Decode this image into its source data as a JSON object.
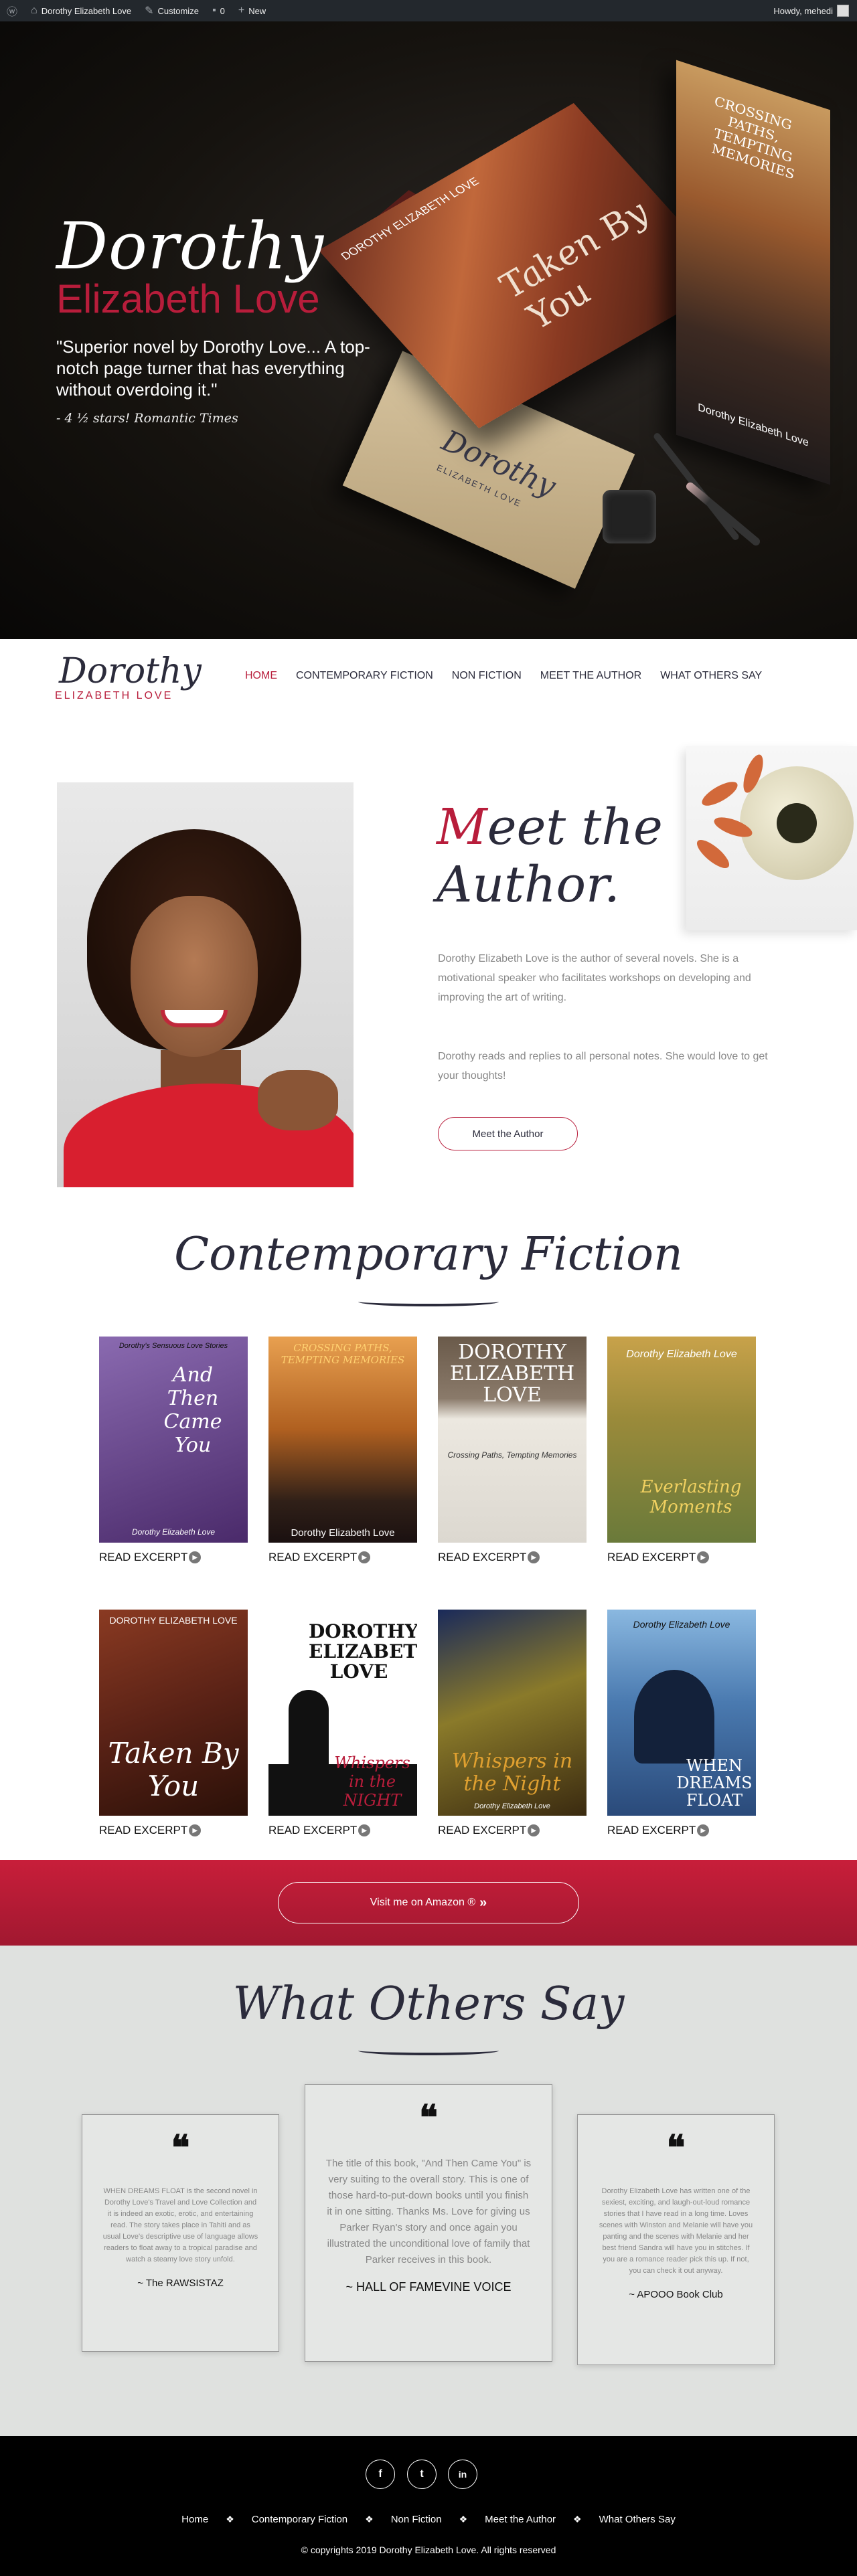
{
  "adminbar": {
    "site_name": "Dorothy Elizabeth Love",
    "customize": "Customize",
    "comments_count": "0",
    "new": "New",
    "howdy": "Howdy, mehedi"
  },
  "hero": {
    "title_line1": "Dorothy",
    "title_line2": "Elizabeth Love",
    "quote": "\"Superior novel by Dorothy Love... A top-notch page turner that has everything without overdoing it.\"",
    "cite": "- 4 ½ stars! Romantic Times",
    "book1_title": "Taken By You",
    "book1_author": "DOROTHY ELIZABETH LOVE",
    "book2_title": "CROSSING PATHS, TEMPTING MEMORIES",
    "book2_author": "Dorothy Elizabeth Love",
    "envelope_script": "Dorothy",
    "envelope_sub": "ELIZABETH LOVE"
  },
  "nav": {
    "logo_line1": "Dorothy",
    "logo_line2": "ELIZABETH LOVE",
    "items": [
      "HOME",
      "CONTEMPORARY FICTION",
      "NON FICTION",
      "MEET THE AUTHOR",
      "WHAT OTHERS SAY"
    ]
  },
  "meet": {
    "heading_first_letter": "M",
    "heading_rest": "eet the",
    "heading_line2": "Author.",
    "p1": "Dorothy Elizabeth Love is the author of several novels. She is a motivational speaker who facilitates workshops on developing and improving the art of writing.",
    "p2": "Dorothy reads and replies to all personal notes. She would love to get your thoughts!",
    "button": "Meet the Author"
  },
  "fiction": {
    "title": "Contemporary Fiction",
    "excerpt_label": "READ EXCERPT",
    "books": [
      {
        "top": "Dorothy's Sensuous Love Stories",
        "title": "And Then Came You",
        "author": "Dorothy Elizabeth Love",
        "bg": "#6a4a8a"
      },
      {
        "top": "CROSSING PATHS, TEMPTING MEMORIES",
        "title": "",
        "author": "Dorothy Elizabeth Love",
        "bg": "#b9732e"
      },
      {
        "top": "DOROTHY ELIZABETH LOVE",
        "title": "Crossing Paths, Tempting Memories",
        "author": "",
        "bg": "#e8e4dc"
      },
      {
        "top": "Dorothy Elizabeth Love",
        "title": "Everlasting Moments",
        "author": "",
        "bg": "#7a8a2a"
      },
      {
        "top": "DOROTHY ELIZABETH LOVE",
        "title": "Taken By You",
        "author": "",
        "bg": "#5a2216"
      },
      {
        "top": "DOROTHY ELIZABETH LOVE",
        "title": "Whispers in the NIGHT",
        "author": "",
        "bg": "#ffffff"
      },
      {
        "top": "",
        "title": "Whispers in the Night",
        "author": "Dorothy Elizabeth Love",
        "bg": "#2a2a20"
      },
      {
        "top": "Dorothy Elizabeth Love",
        "title": "WHEN DREAMS FLOAT",
        "author": "",
        "bg": "#3a5e86"
      }
    ]
  },
  "amazon": {
    "button": "Visit me on Amazon ®",
    "arrows": "»"
  },
  "testimonials": {
    "title": "What Others Say",
    "quote_mark": "❝",
    "items": [
      {
        "body": "WHEN DREAMS FLOAT is the second novel in Dorothy Love's Travel and Love Collection and it is indeed an exotic, erotic, and entertaining read. The story takes place in Tahiti and as usual Love's descriptive use of language allows readers to float away to a tropical paradise and watch a steamy love story unfold.",
        "author": "~ The RAWSISTAZ"
      },
      {
        "body": "The title of this book, \"And Then Came You\" is very suiting to the overall story. This is one of those hard-to-put-down books until you finish it in one sitting. Thanks Ms. Love for giving us Parker Ryan's story and once again you illustrated the unconditional love of family that Parker receives in this book.",
        "author": "~ HALL OF FAMEVINE VOICE"
      },
      {
        "body": "Dorothy Elizabeth Love has written one of the sexiest, exciting, and laugh-out-loud romance stories that I have read in a long time. Loves scenes with Winston and Melanie will have you panting and the scenes with Melanie and her best friend Sandra will have you in stitches. If you are a romance reader pick this up. If not, you can check it out anyway.",
        "author": "~ APOOO Book Club"
      }
    ]
  },
  "footer": {
    "social": [
      "f",
      "t",
      "in"
    ],
    "menu": [
      "Home",
      "Contemporary Fiction",
      "Non Fiction",
      "Meet the Author",
      "What Others Say"
    ],
    "separator": "❖",
    "copyright": "© copyrights 2019 Dorothy Elizabeth Love. All rights reserved"
  }
}
